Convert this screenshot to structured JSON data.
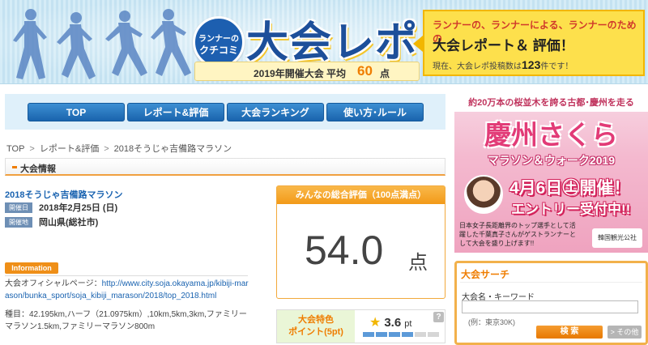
{
  "header": {
    "badge_line1": "ランナーの",
    "badge_line2": "クチコミ",
    "logo_text": "大会レポ",
    "avg_label": "2019年開催大会 平均",
    "avg_value": "60",
    "avg_unit": "点",
    "tagline": "ランナーの、ランナーによる、ランナーのための",
    "headline": "大会レポート＆ 評価！",
    "count_prefix": "現在、大会レポ投稿数は",
    "count_value": "123",
    "count_suffix": "件です！"
  },
  "nav": {
    "items": [
      {
        "label": "TOP"
      },
      {
        "label": "レポート&評価"
      },
      {
        "label": "大会ランキング"
      },
      {
        "label": "使い方･ルール"
      }
    ]
  },
  "breadcrumb": {
    "items": [
      "TOP",
      "レポート&評価",
      "2018そうじゃ吉備路マラソン"
    ],
    "separator": ">"
  },
  "section": {
    "title": "大会情報"
  },
  "race": {
    "name": "2018そうじゃ吉備路マラソン",
    "date_chip": "開催日",
    "date": "2018年2月25日 (日)",
    "place_chip": "開催地",
    "place": "岡山県(総社市)"
  },
  "information": {
    "title": "Information",
    "official_prefix": "大会オフィシャルページ：",
    "official_url": "http://www.city.soja.okayama.jp/kibiji-marason/bunka_sport/soja_kibiji_marason/2018/top_2018.html",
    "distances": "種目：42.195km,ハーフ（21.0975km）,10km,5km,3km,ファミリーマラソン1.5km,ファミリーマラソン800m"
  },
  "score": {
    "header": "みんなの総合評価（100点満点）",
    "value": "54.0",
    "unit": "点"
  },
  "feature": {
    "label_line1": "大会特色",
    "label_line2": "ポイント(5pt)",
    "star": "★",
    "value": "3.6",
    "unit": "pt",
    "level": 0.72,
    "help": "?"
  },
  "ad": {
    "top": "約20万本の桜並木を誇る古都･慶州を走る",
    "title": "慶州さくら",
    "subtitle": "マラソン＆ウォーク2019",
    "date": "4月6日㊏開催！",
    "entry": "エントリー受付中!!",
    "note": "日本女子長距離界のトップ選手として活躍した千葉真子さんがゲストランナーとして大会を盛り上げます!!",
    "sponsor": "韓国観光公社"
  },
  "search": {
    "title": "大会サーチ",
    "label": "大会名・キーワード",
    "input_value": "",
    "example": "(例：東京30K)",
    "search_button": "検 索",
    "other_button": "> その他"
  }
}
